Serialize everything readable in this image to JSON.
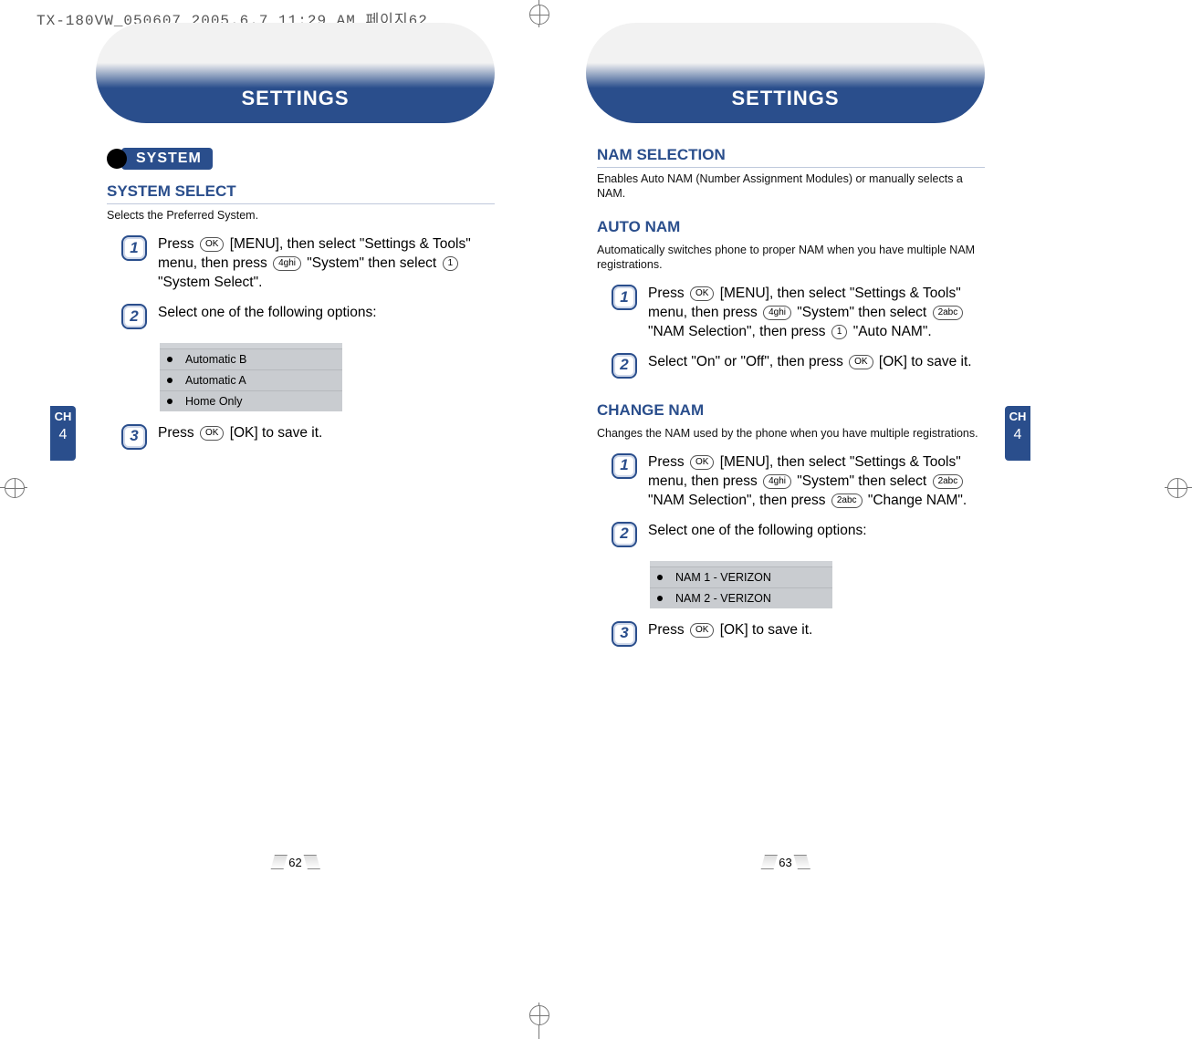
{
  "prepress_header": "TX-180VW_050607  2005.6.7 11:29 AM  페이지62",
  "chapter": {
    "label": "CH",
    "num": "4"
  },
  "left_page": {
    "header": "SETTINGS",
    "section_chip": "SYSTEM",
    "h2": "SYSTEM SELECT",
    "desc": "Selects the Preferred System.",
    "steps": {
      "s1": {
        "num": "1",
        "before_key1": "Press ",
        "key1": "OK",
        "after_key1": " [MENU], then select \"Settings & Tools\" menu, then press ",
        "key2": "4ghi",
        "after_key2": " \"System\" then select ",
        "key3": "1",
        "after_key3": " \"System Select\"."
      },
      "s2": {
        "num": "2",
        "text": "Select one of the following options:"
      },
      "s3": {
        "num": "3",
        "before_key": "Press ",
        "key": "OK",
        "after_key": " [OK] to save it."
      }
    },
    "options": [
      "Automatic B",
      "Automatic A",
      "Home Only"
    ],
    "page_number": "62"
  },
  "right_page": {
    "header": "SETTINGS",
    "nam_sel": {
      "h2": "NAM SELECTION",
      "desc": "Enables Auto NAM (Number Assignment Modules) or manually selects a NAM."
    },
    "auto_nam": {
      "h2": "AUTO NAM",
      "desc": "Automatically switches phone to proper NAM when you have multiple NAM registrations.",
      "s1": {
        "num": "1",
        "before_key1": "Press ",
        "key1": "OK",
        "after_key1": " [MENU], then select \"Settings & Tools\" menu, then press ",
        "key2": "4ghi",
        "after_key2": " \"System\" then select ",
        "key3": "2abc",
        "after_key3": " \"NAM Selection\", then press ",
        "key4": "1",
        "after_key4": " \"Auto NAM\"."
      },
      "s2": {
        "num": "2",
        "before": "Select \"On\" or \"Off\", then press ",
        "key": "OK",
        "after": " [OK] to save it."
      }
    },
    "change_nam": {
      "h2": "CHANGE NAM",
      "desc": "Changes the NAM used by the phone when you have multiple registrations.",
      "s1": {
        "num": "1",
        "before_key1": "Press ",
        "key1": "OK",
        "after_key1": " [MENU], then select \"Settings & Tools\" menu, then press ",
        "key2": "4ghi",
        "after_key2": " \"System\" then select ",
        "key3": "2abc",
        "after_key3": " \"NAM Selection\", then press ",
        "key4": "2abc",
        "after_key4": " \"Change NAM\"."
      },
      "s2": {
        "num": "2",
        "text": "Select one of the following options:"
      },
      "options": [
        "NAM 1 - VERIZON",
        "NAM 2 - VERIZON"
      ],
      "s3": {
        "num": "3",
        "before_key": "Press ",
        "key": "OK",
        "after_key": " [OK] to save it."
      }
    },
    "page_number": "63"
  }
}
